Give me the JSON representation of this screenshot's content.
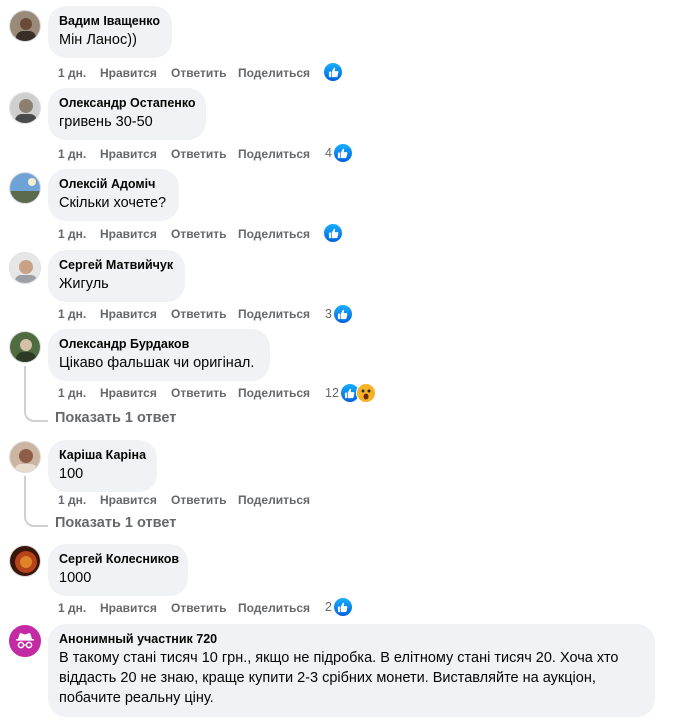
{
  "actions": {
    "time": "1 дн.",
    "like": "Нравится",
    "reply": "Ответить",
    "share": "Поделиться"
  },
  "show_replies": "Показать 1 ответ",
  "comments": [
    {
      "author": "Вадим Іващенко",
      "text": "Мін Ланос))",
      "reaction_count": "",
      "reactions": [
        "like"
      ]
    },
    {
      "author": "Олександр Остапенко",
      "text": "гривень 30-50",
      "reaction_count": "4",
      "reactions": [
        "like"
      ]
    },
    {
      "author": "Олексій Адоміч",
      "text": "Скільки хочете?",
      "reaction_count": "",
      "reactions": [
        "like"
      ]
    },
    {
      "author": "Сергей Матвийчук",
      "text": "Жигуль",
      "reaction_count": "3",
      "reactions": [
        "like"
      ]
    },
    {
      "author": "Олександр Бурдаков",
      "text": "Цікаво фальшак чи оригінал.",
      "reaction_count": "12",
      "reactions": [
        "like",
        "wow"
      ]
    },
    {
      "author": "Каріша Каріна",
      "text": "100",
      "reaction_count": "",
      "reactions": []
    },
    {
      "author": "Сергей Колесников",
      "text": "1000",
      "reaction_count": "2",
      "reactions": [
        "like"
      ]
    },
    {
      "author": "Анонимный участник 720",
      "text": "В такому стані тисяч 10 грн., якщо не підробка. В елітному стані тисяч 20. Хоча хто віддасть 20 не знаю, краще купити 2-3 срібних монети. Виставляйте на аукціон, побачите реальну ціну.",
      "reaction_count": "",
      "reactions": []
    }
  ],
  "colors": {
    "bubble": "#f0f2f5",
    "meta_text": "#65676b",
    "like_blue": "#1877f2",
    "wow_yellow": "#f7b125",
    "anonymous_avatar": "#c32aa3"
  }
}
